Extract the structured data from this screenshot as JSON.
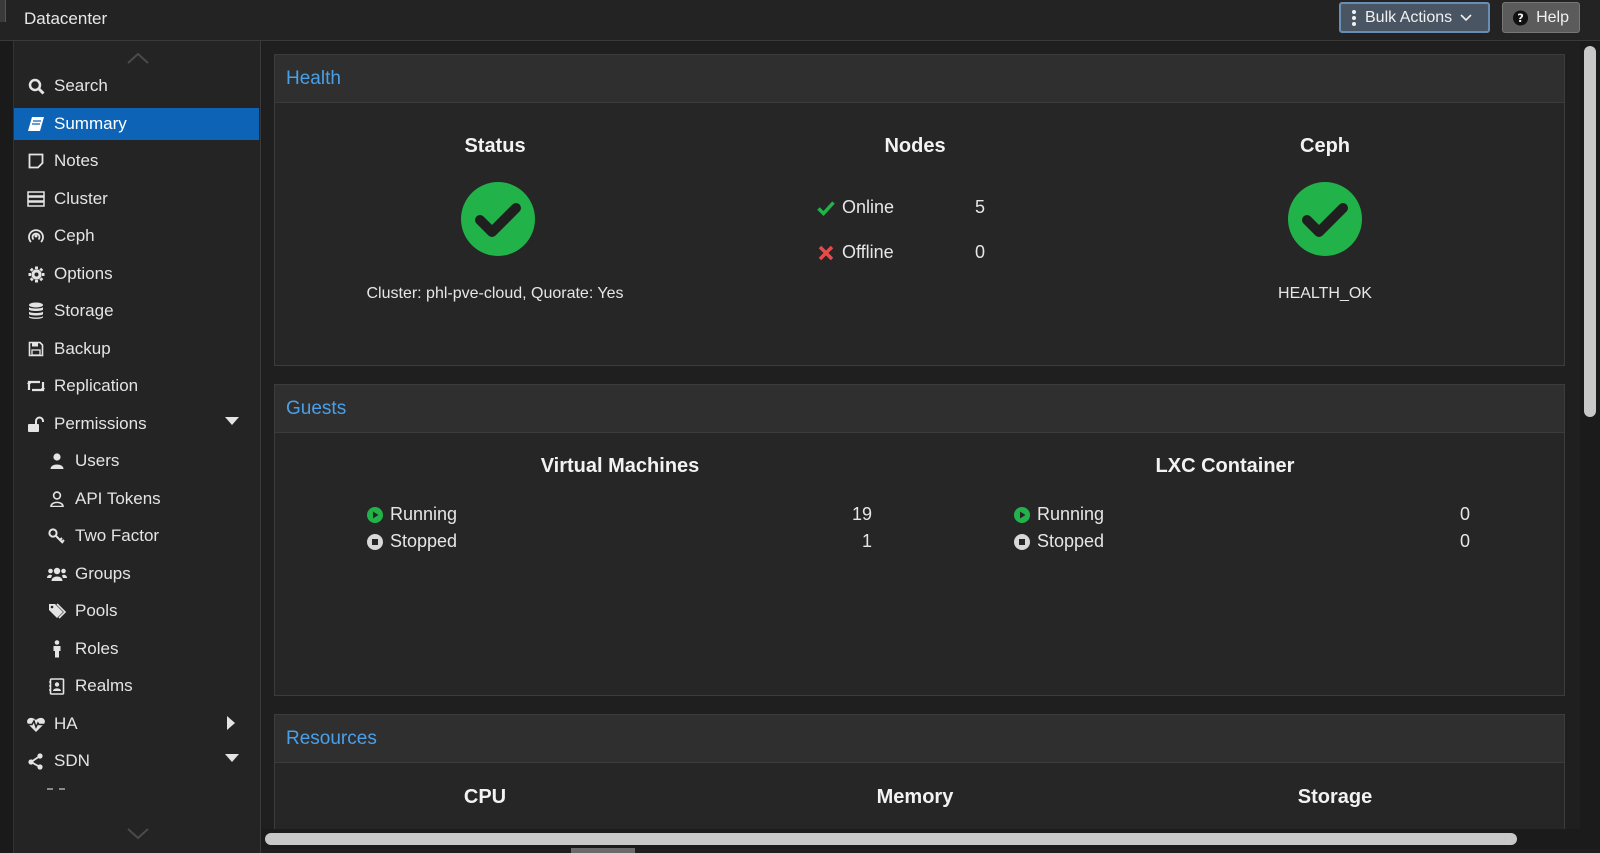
{
  "header": {
    "title": "Datacenter",
    "bulk_actions_label": "Bulk Actions",
    "help_label": "Help"
  },
  "sidebar": {
    "items": [
      {
        "label": "Search",
        "icon": "search-icon"
      },
      {
        "label": "Summary",
        "icon": "book-icon",
        "active": true
      },
      {
        "label": "Notes",
        "icon": "note-icon"
      },
      {
        "label": "Cluster",
        "icon": "server-icon"
      },
      {
        "label": "Ceph",
        "icon": "ceph-icon"
      },
      {
        "label": "Options",
        "icon": "gear-icon"
      },
      {
        "label": "Storage",
        "icon": "database-icon"
      },
      {
        "label": "Backup",
        "icon": "floppy-icon"
      },
      {
        "label": "Replication",
        "icon": "retweet-icon"
      },
      {
        "label": "Permissions",
        "icon": "unlock-icon",
        "expanded": true
      },
      {
        "label": "Users",
        "icon": "user-icon",
        "sub": true
      },
      {
        "label": "API Tokens",
        "icon": "user-outline-icon",
        "sub": true
      },
      {
        "label": "Two Factor",
        "icon": "key-icon",
        "sub": true
      },
      {
        "label": "Groups",
        "icon": "users-icon",
        "sub": true
      },
      {
        "label": "Pools",
        "icon": "tags-icon",
        "sub": true
      },
      {
        "label": "Roles",
        "icon": "male-icon",
        "sub": true
      },
      {
        "label": "Realms",
        "icon": "address-book-icon",
        "sub": true
      },
      {
        "label": "HA",
        "icon": "heartbeat-icon",
        "collapsed": true
      },
      {
        "label": "SDN",
        "icon": "sdn-icon",
        "expanded": true
      }
    ]
  },
  "health": {
    "title": "Health",
    "status": {
      "title": "Status",
      "caption": "Cluster: phl-pve-cloud, Quorate: Yes"
    },
    "nodes": {
      "title": "Nodes",
      "online_label": "Online",
      "online_count": "5",
      "offline_label": "Offline",
      "offline_count": "0"
    },
    "ceph": {
      "title": "Ceph",
      "caption": "HEALTH_OK"
    }
  },
  "guests": {
    "title": "Guests",
    "vms": {
      "title": "Virtual Machines",
      "running_label": "Running",
      "running_count": "19",
      "stopped_label": "Stopped",
      "stopped_count": "1"
    },
    "lxc": {
      "title": "LXC Container",
      "running_label": "Running",
      "running_count": "0",
      "stopped_label": "Stopped",
      "stopped_count": "0"
    }
  },
  "resources": {
    "title": "Resources",
    "cpu_title": "CPU",
    "memory_title": "Memory",
    "storage_title": "Storage"
  },
  "colors": {
    "accent_blue": "#0d64b6",
    "header_link_blue": "#49a0e8",
    "status_green": "#21b34a",
    "status_red": "#e84a4a"
  }
}
